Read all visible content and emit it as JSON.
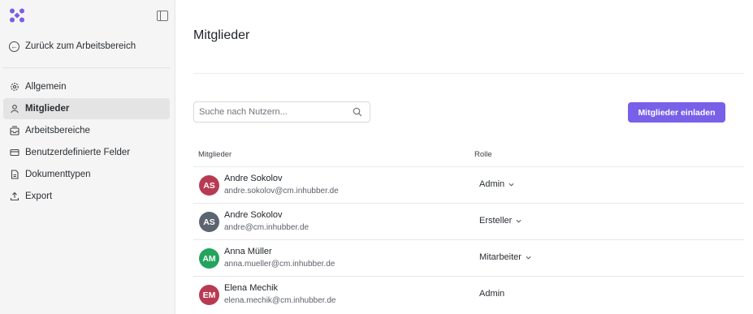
{
  "sidebar": {
    "back_label": "Zurück zum Arbeitsbereich",
    "items": [
      {
        "label": "Allgemein",
        "icon": "gear-icon",
        "active": false
      },
      {
        "label": "Mitglieder",
        "icon": "user-icon",
        "active": true
      },
      {
        "label": "Arbeitsbereiche",
        "icon": "inbox-icon",
        "active": false
      },
      {
        "label": "Benutzerdefinierte Felder",
        "icon": "card-icon",
        "active": false
      },
      {
        "label": "Dokumenttypen",
        "icon": "file-icon",
        "active": false
      },
      {
        "label": "Export",
        "icon": "upload-icon",
        "active": false
      }
    ]
  },
  "main": {
    "title": "Mitglieder",
    "search_placeholder": "Suche nach Nutzern...",
    "invite_label": "Mitglieder einladen",
    "columns": {
      "member": "Mitglieder",
      "role": "Rolle"
    },
    "members": [
      {
        "initials": "AS",
        "name": "Andre Sokolov",
        "email": "andre.sokolov@cm.inhubber.de",
        "role": "Admin",
        "has_dropdown": true,
        "avatar_color": "#b83a52"
      },
      {
        "initials": "AS",
        "name": "Andre Sokolov",
        "email": "andre@cm.inhubber.de",
        "role": "Ersteller",
        "has_dropdown": true,
        "avatar_color": "#5c6470"
      },
      {
        "initials": "AM",
        "name": "Anna Müller",
        "email": "anna.mueller@cm.inhubber.de",
        "role": "Mitarbeiter",
        "has_dropdown": true,
        "avatar_color": "#22a45d"
      },
      {
        "initials": "EM",
        "name": "Elena Mechik",
        "email": "elena.mechik@cm.inhubber.de",
        "role": "Admin",
        "has_dropdown": false,
        "avatar_color": "#b83a52"
      }
    ]
  },
  "colors": {
    "accent": "#7860e8",
    "logo": "#7b5ce6"
  }
}
